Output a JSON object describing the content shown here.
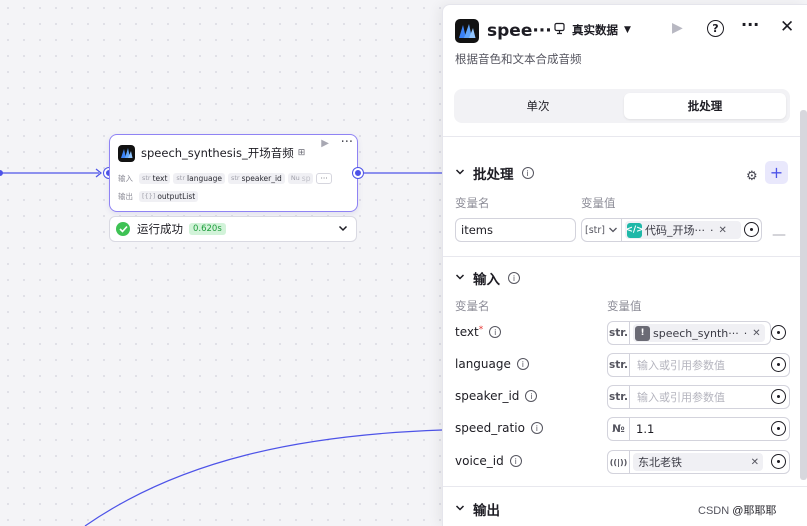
{
  "node": {
    "title": "speech_synthesis_开场音频",
    "input_label": "输入",
    "output_label": "输出",
    "inputs": [
      {
        "type": "str",
        "name": "text"
      },
      {
        "type": "str",
        "name": "language"
      },
      {
        "type": "str",
        "name": "speaker_id"
      },
      {
        "type": "Nu",
        "name": "sp"
      }
    ],
    "more_inputs": "···",
    "outputs": [
      {
        "type": "[{}]",
        "name": "outputList"
      }
    ]
  },
  "status": {
    "text": "运行成功",
    "time": "0.620s"
  },
  "panel": {
    "title": "speech_synthesis_开场音频",
    "title_short": "spee···",
    "mode": "真实数据",
    "description": "根据音色和文本合成音频",
    "tabs": [
      "单次",
      "批处理"
    ],
    "active_tab": "批处理",
    "batch": {
      "title": "批处理",
      "col_name": "变量名",
      "col_value": "变量值",
      "name_value": "items",
      "type_value": "[str]",
      "ref_text": "代码_开场···",
      "ref_suffix": "·"
    },
    "inputs": {
      "title": "输入",
      "col_name": "变量名",
      "col_value": "变量值",
      "fields": [
        {
          "name": "text",
          "required": true,
          "type": "str.",
          "ref_text": "speech_synth···",
          "ref_suffix": "·",
          "placeholder": ""
        },
        {
          "name": "language",
          "required": false,
          "type": "str.",
          "ref_text": "",
          "placeholder": "输入或引用参数值"
        },
        {
          "name": "speaker_id",
          "required": false,
          "type": "str.",
          "ref_text": "",
          "placeholder": "输入或引用参数值"
        },
        {
          "name": "speed_ratio",
          "required": false,
          "type": "№",
          "value": "1.1"
        },
        {
          "name": "voice_id",
          "required": false,
          "type": "((|))",
          "value": "东北老铁"
        }
      ]
    },
    "outputs": {
      "title": "输出"
    }
  },
  "watermark": {
    "prefix": "CSDN",
    "name": "@耶耶耶"
  },
  "colors": {
    "accent": "#4d53e8",
    "success": "#3ec254",
    "node_border": "#8f83f4",
    "ref_code": "#1fb8a8",
    "ref_node": "#6b6b75"
  }
}
